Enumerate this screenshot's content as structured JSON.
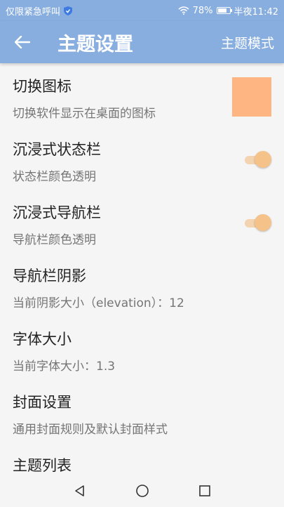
{
  "status_bar": {
    "carrier": "仅限紧急呼叫",
    "battery_percent": "78%",
    "battery_level": 0.78,
    "time": "半夜11:42"
  },
  "app_bar": {
    "back_icon": "arrow-left-icon",
    "title": "主题设置",
    "action_label": "主题模式"
  },
  "settings": [
    {
      "title": "切换图标",
      "subtitle": "切换软件显示在桌面的图标",
      "control": "color-swatch",
      "color": "#ffb582"
    },
    {
      "title": "沉浸式状态栏",
      "subtitle": "状态栏颜色透明",
      "control": "toggle",
      "on": true
    },
    {
      "title": "沉浸式导航栏",
      "subtitle": "导航栏颜色透明",
      "control": "toggle",
      "on": true
    },
    {
      "title": "导航栏阴影",
      "subtitle": "当前阴影大小（elevation）：12"
    },
    {
      "title": "字体大小",
      "subtitle": "当前字体大小：1.3"
    },
    {
      "title": "封面设置",
      "subtitle": "通用封面规则及默认封面样式"
    },
    {
      "title": "主题列表"
    }
  ],
  "colors": {
    "primary": "#88aee0",
    "accent": "#f5c28a",
    "swatch": "#ffb582"
  },
  "nav_bar": {
    "icons": [
      "back-triangle-icon",
      "home-circle-icon",
      "recents-square-icon"
    ]
  }
}
